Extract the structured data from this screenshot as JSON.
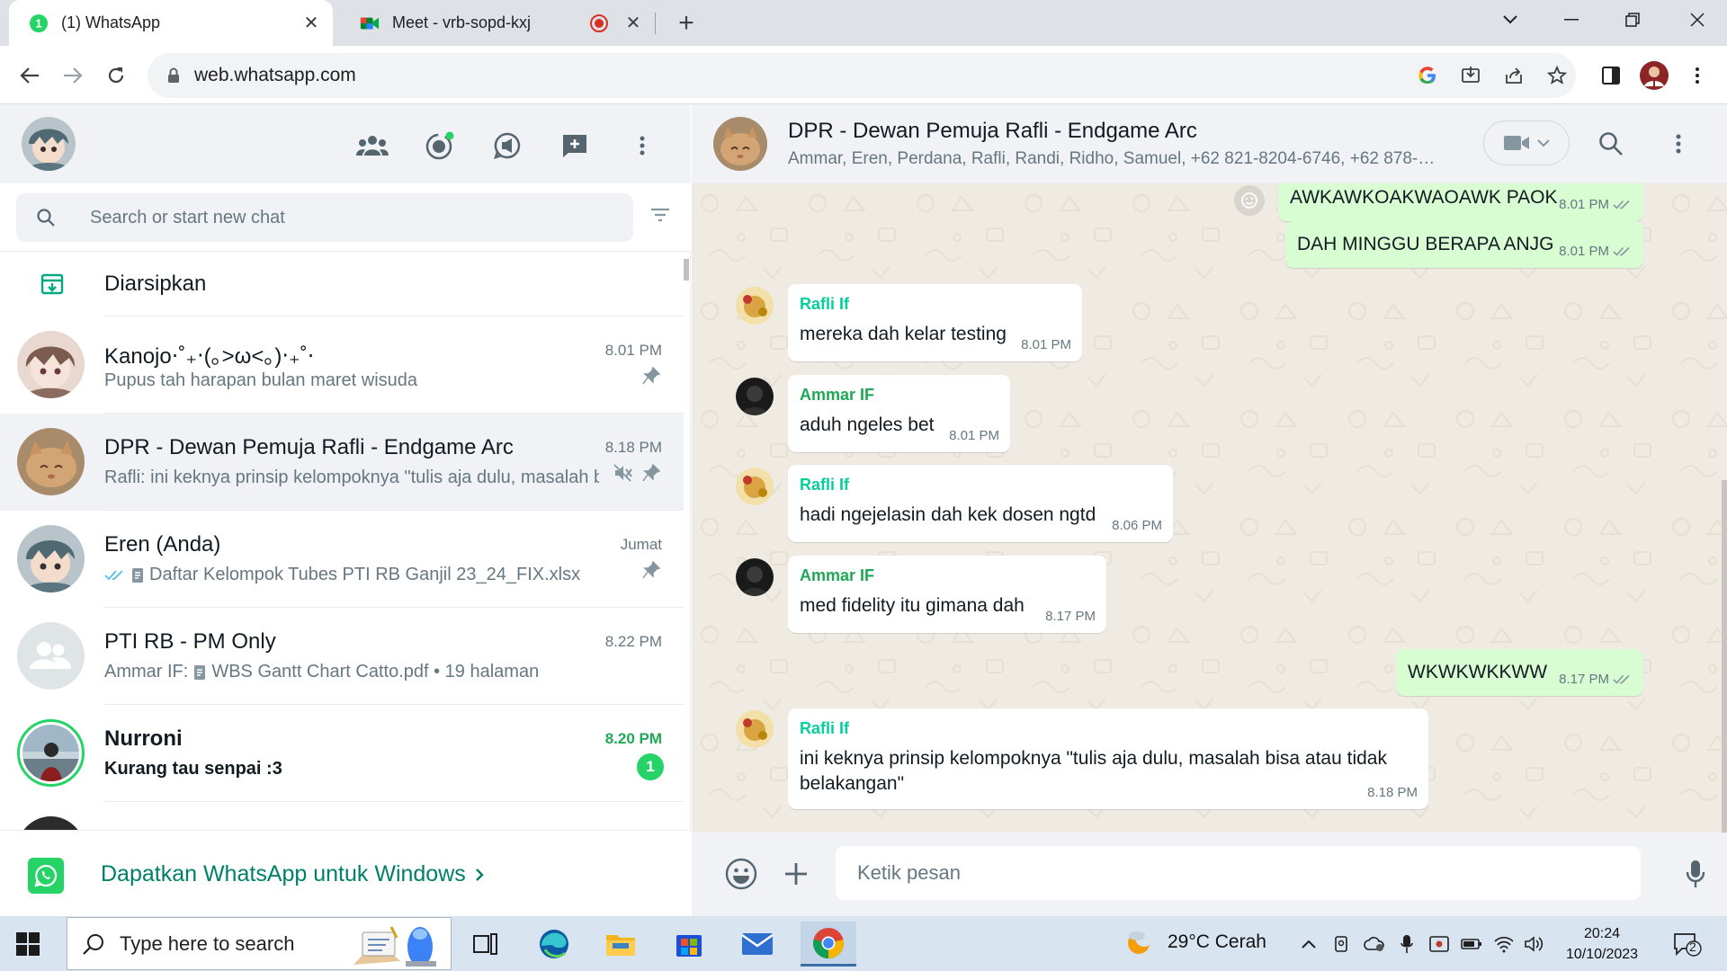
{
  "browser": {
    "tabs": [
      {
        "title": "(1) WhatsApp",
        "badge": "1",
        "active": true
      },
      {
        "title": "Meet - vrb-sopd-kxj",
        "active": false,
        "recording": true
      }
    ],
    "url": "web.whatsapp.com"
  },
  "left_panel": {
    "search_placeholder": "Search or start new chat",
    "archived_label": "Diarsipkan",
    "chats": [
      {
        "name": "Kanojo⋅˚₊‧(｡>ω<｡)‧₊˚⋅",
        "time": "8.01 PM",
        "preview": "Pupus tah harapan bulan maret wisuda",
        "pinned": true
      },
      {
        "name": "DPR - Dewan Pemuja Rafli - Endgame Arc",
        "time": "8.18 PM",
        "preview": "Rafli: ini keknya prinsip kelompoknya \"tulis aja dulu, masalah bisa atau tidak belakangan\"",
        "muted": true,
        "pinned": true,
        "selected": true
      },
      {
        "name": "Eren (Anda)",
        "time": "Jumat",
        "preview": "Daftar Kelompok Tubes PTI RB Ganjil 23_24_FIX.xlsx",
        "pinned": true
      },
      {
        "name": "PTI RB - PM Only",
        "time": "8.22 PM",
        "preview_prefix": "Ammar IF:",
        "preview": "WBS Gantt Chart Catto.pdf • 19 halaman"
      },
      {
        "name": "Nurroni",
        "time": "8.20 PM",
        "preview": "Kurang tau senpai :3",
        "unread": "1"
      }
    ],
    "promo_text": "Dapatkan WhatsApp untuk Windows"
  },
  "conversation": {
    "group_name": "DPR - Dewan Pemuja Rafli - Endgame Arc",
    "members": "Ammar, Eren, Perdana, Rafli, Randi, Ridho, Samuel, +62 821-8204-6746, +62 878-6...",
    "messages": [
      {
        "direction": "out",
        "text": "AWKAWKOAKWAOAWK PAOK",
        "time": "8.01 PM"
      },
      {
        "direction": "out",
        "text": "DAH MINGGU BERAPA ANJG",
        "time": "8.01 PM"
      },
      {
        "direction": "in",
        "sender": "Rafli If",
        "text": "mereka dah kelar testing",
        "time": "8.01 PM"
      },
      {
        "direction": "in",
        "sender": "Ammar IF",
        "text": "aduh ngeles bet",
        "time": "8.01 PM"
      },
      {
        "direction": "in",
        "sender": "Rafli If",
        "text": "hadi ngejelasin dah kek dosen ngtd",
        "time": "8.06 PM"
      },
      {
        "direction": "in",
        "sender": "Ammar IF",
        "text": "med fidelity itu gimana dah",
        "time": "8.17 PM"
      },
      {
        "direction": "out",
        "text": "WKWKWKKWW",
        "time": "8.17 PM"
      },
      {
        "direction": "in",
        "sender": "Rafli If",
        "text_line1": "ini keknya prinsip kelompoknya \"tulis aja dulu, masalah bisa atau tidak",
        "text_line2": "belakangan\"",
        "time": "8.18 PM"
      }
    ],
    "composer_placeholder": "Ketik pesan"
  },
  "taskbar": {
    "search_placeholder": "Type here to search",
    "weather": "29°C  Cerah",
    "time": "20:24",
    "date": "10/10/2023",
    "notifications": "2"
  },
  "colors": {
    "wa_green": "#25d366",
    "wa_teal": "#008069",
    "outgoing_bubble": "#d9fdd3",
    "chat_bg": "#efeae2",
    "rafli_name": "#06cf9c",
    "ammar_name": "#1fa855"
  }
}
